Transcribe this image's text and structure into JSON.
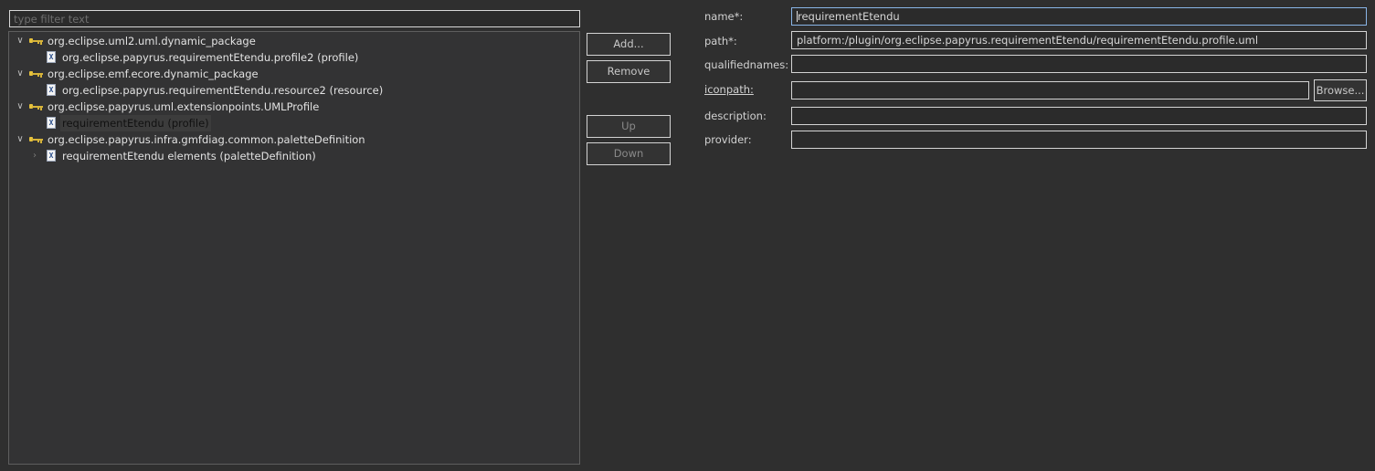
{
  "filter": {
    "placeholder": "type filter text",
    "value": ""
  },
  "tree": [
    {
      "type": "plugin",
      "label": "org.eclipse.uml2.uml.dynamic_package",
      "expanded": true
    },
    {
      "type": "file",
      "label": "org.eclipse.papyrus.requirementEtendu.profile2 (profile)"
    },
    {
      "type": "plugin",
      "label": "org.eclipse.emf.ecore.dynamic_package",
      "expanded": true
    },
    {
      "type": "file",
      "label": "org.eclipse.papyrus.requirementEtendu.resource2 (resource)"
    },
    {
      "type": "plugin",
      "label": "org.eclipse.papyrus.uml.extensionpoints.UMLProfile",
      "expanded": true
    },
    {
      "type": "file",
      "label": "requirementEtendu (profile)",
      "selected": true
    },
    {
      "type": "plugin",
      "label": "org.eclipse.papyrus.infra.gmfdiag.common.paletteDefinition",
      "expanded": true
    },
    {
      "type": "file",
      "label": "requirementEtendu elements (paletteDefinition)",
      "collapsed_child": true
    }
  ],
  "file_icon_glyph": "X",
  "twisty_expanded": "∨",
  "twisty_collapsed": "›",
  "buttons": {
    "add": "Add...",
    "remove": "Remove",
    "up": "Up",
    "down": "Down"
  },
  "form": {
    "name_label": "name*:",
    "name_value": "requirementEtendu",
    "path_label": "path*:",
    "path_value": "platform:/plugin/org.eclipse.papyrus.requirementEtendu/requirementEtendu.profile.uml",
    "qualifiednames_label": "qualifiednames:",
    "qualifiednames_value": "",
    "iconpath_label": "iconpath:",
    "iconpath_value": "",
    "browse_label": "Browse...",
    "description_label": "description:",
    "description_value": "",
    "provider_label": "provider:",
    "provider_value": ""
  },
  "colors": {
    "background": "#2f2f2f",
    "tree_background": "#333334",
    "plugin_icon": "#e6c23c",
    "focus_border": "#8ab6e8"
  }
}
